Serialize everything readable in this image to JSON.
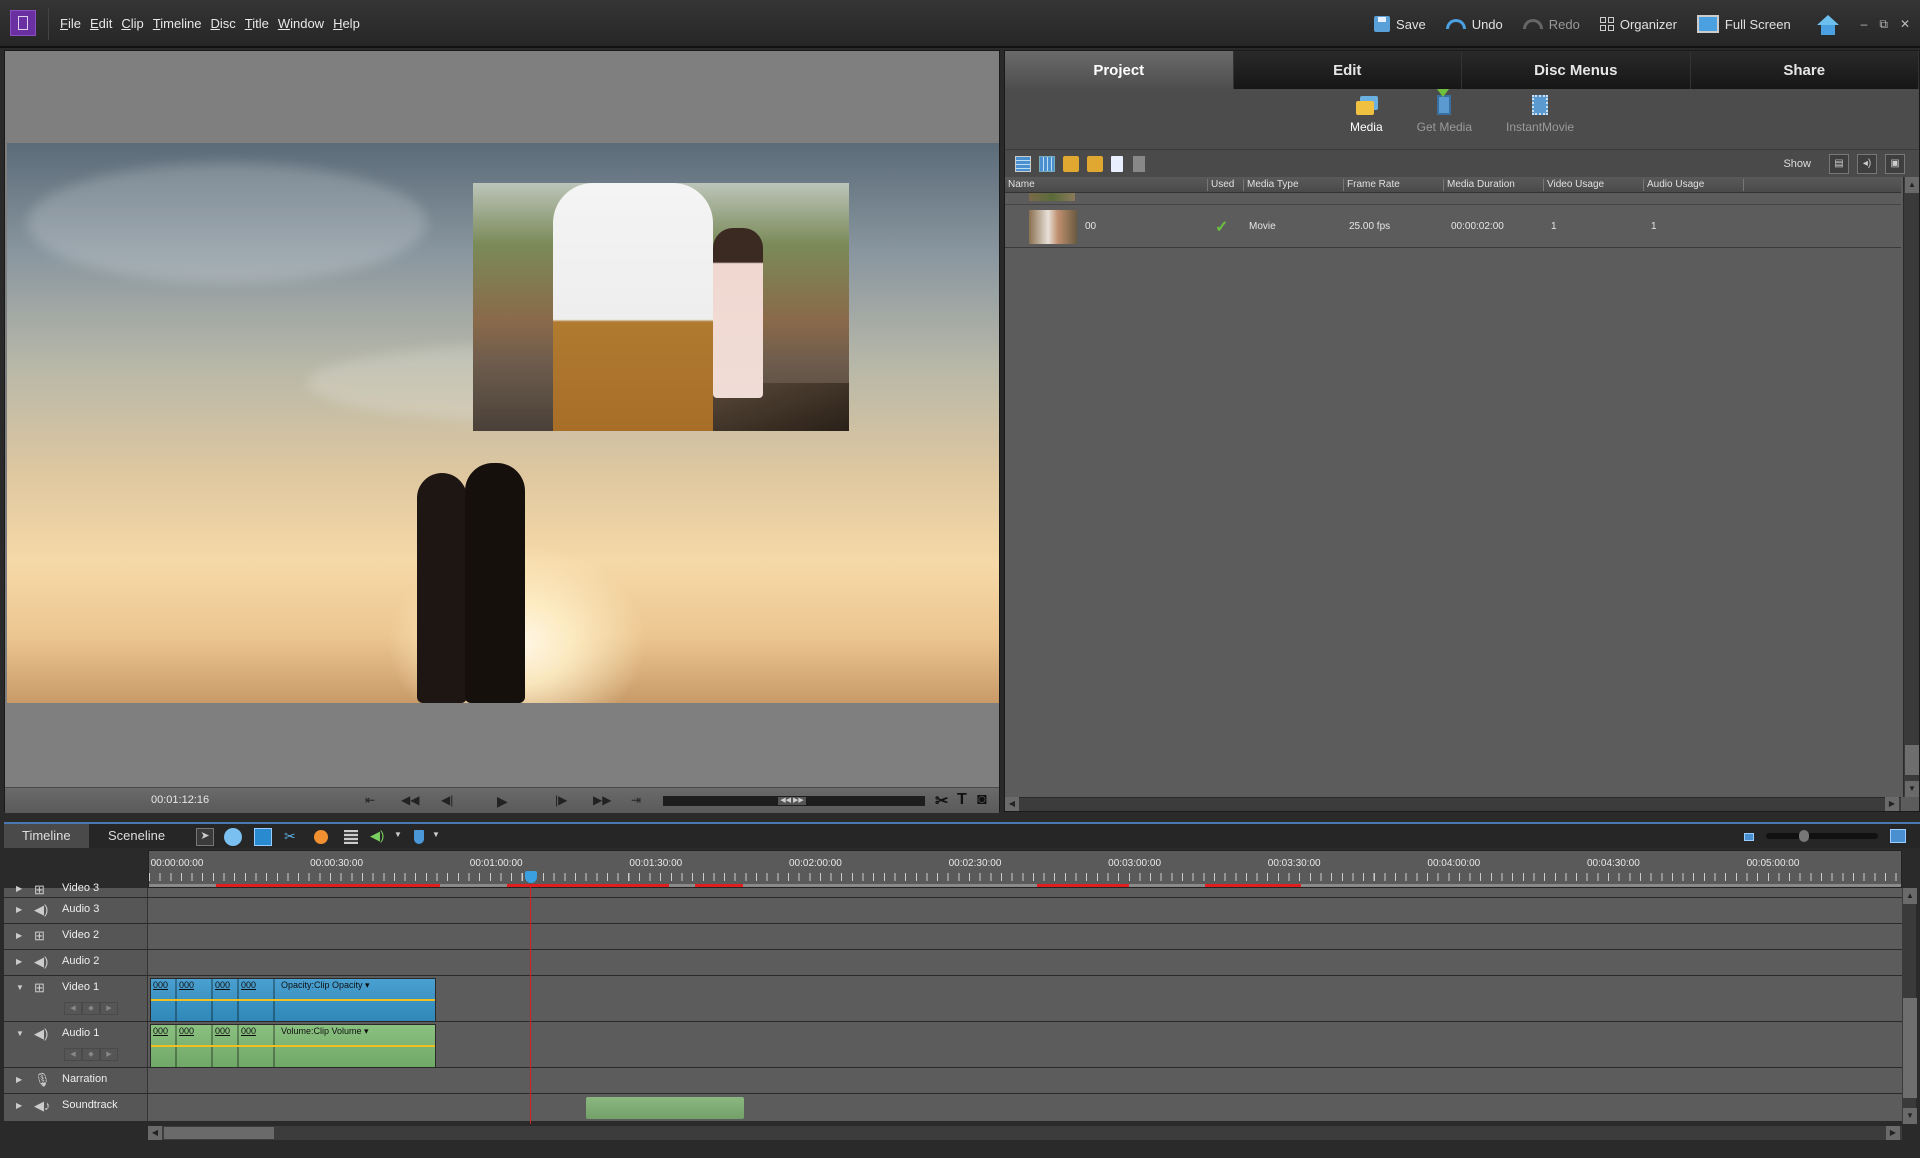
{
  "window": {
    "menu": [
      "File",
      "Edit",
      "Clip",
      "Timeline",
      "Disc",
      "Title",
      "Window",
      "Help"
    ],
    "toolbar": {
      "save": "Save",
      "undo": "Undo",
      "redo": "Redo",
      "organizer": "Organizer",
      "fullscreen": "Full Screen"
    },
    "controls": {
      "minimize": "–",
      "restore": "⧉",
      "close": "✕"
    }
  },
  "monitor": {
    "timecode": "00:01:12:16",
    "transport": [
      "step-back-to-start",
      "rewind",
      "step-back",
      "play",
      "step-forward",
      "fast-forward",
      "step-to-end"
    ],
    "tools": {
      "split": "✂",
      "title": "T",
      "snapshot": "◙"
    }
  },
  "panel": {
    "tabs": [
      {
        "label": "Project",
        "active": true
      },
      {
        "label": "Edit",
        "active": false
      },
      {
        "label": "Disc Menus",
        "active": false
      },
      {
        "label": "Share",
        "active": false
      }
    ],
    "subnav": [
      {
        "label": "Media",
        "active": true
      },
      {
        "label": "Get Media",
        "active": false
      },
      {
        "label": "InstantMovie",
        "active": false
      }
    ],
    "show_label": "Show",
    "columns": [
      "Name",
      "Used",
      "Media Type",
      "Frame Rate",
      "Media Duration",
      "Video Usage",
      "Audio Usage"
    ],
    "rows": [
      {
        "name": "00",
        "used": true,
        "media_type": "Movie",
        "frame_rate": "25.00 fps",
        "duration": "00:00:02:00",
        "video_usage": "1",
        "audio_usage": "1"
      }
    ]
  },
  "timeline": {
    "tabs": [
      {
        "label": "Timeline",
        "active": true
      },
      {
        "label": "Sceneline",
        "active": false
      }
    ],
    "ruler_labels": [
      "00:00:00:00",
      "00:00:30:00",
      "00:01:00:00",
      "00:01:30:00",
      "00:02:00:00",
      "00:02:30:00",
      "00:03:00:00",
      "00:03:30:00",
      "00:04:00:00",
      "00:04:30:00",
      "00:05:00:00"
    ],
    "playhead_time": "00:01:12:16",
    "tracks": [
      {
        "name": "Video 3",
        "type": "video"
      },
      {
        "name": "Audio 3",
        "type": "audio"
      },
      {
        "name": "Video 2",
        "type": "video"
      },
      {
        "name": "Audio 2",
        "type": "audio"
      },
      {
        "name": "Video 1",
        "type": "video",
        "expanded": true
      },
      {
        "name": "Audio 1",
        "type": "audio",
        "expanded": true
      },
      {
        "name": "Narration",
        "type": "narration"
      },
      {
        "name": "Soundtrack",
        "type": "soundtrack"
      }
    ],
    "clip_segment_label": "000",
    "video_clip_label": "Opacity:Clip Opacity ▾",
    "audio_clip_label": "Volume:Clip Volume ▾"
  }
}
